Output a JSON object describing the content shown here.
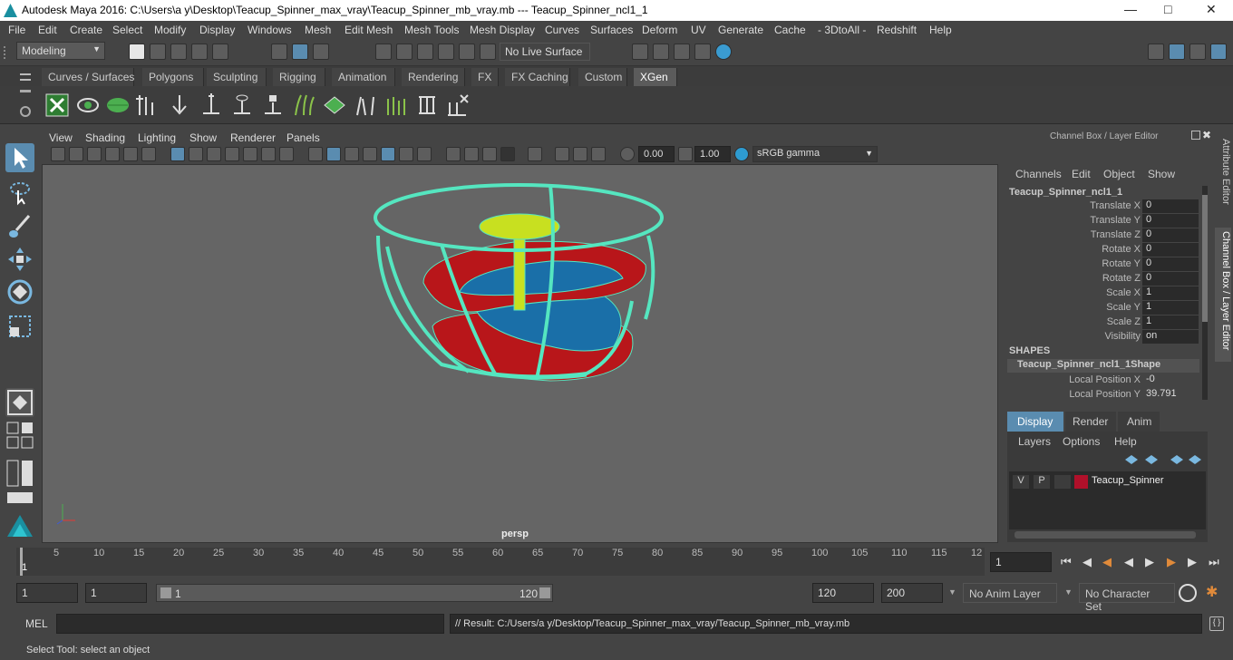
{
  "window": {
    "title": "Autodesk Maya 2016: C:\\Users\\a y\\Desktop\\Teacup_Spinner_max_vray\\Teacup_Spinner_mb_vray.mb   ---   Teacup_Spinner_ncl1_1"
  },
  "menubar": [
    "File",
    "Edit",
    "Create",
    "Select",
    "Modify",
    "Display",
    "Windows",
    "Mesh",
    "Edit Mesh",
    "Mesh Tools",
    "Mesh Display",
    "Curves",
    "Surfaces",
    "Deform",
    "UV",
    "Generate",
    "Cache",
    "- 3DtoAll -",
    "Redshift",
    "Help"
  ],
  "status": {
    "mode": "Modeling",
    "live_surface": "No Live Surface"
  },
  "shelf_tabs": [
    "Curves / Surfaces",
    "Polygons",
    "Sculpting",
    "Rigging",
    "Animation",
    "Rendering",
    "FX",
    "FX Caching",
    "Custom",
    "XGen"
  ],
  "active_shelf_tab": "XGen",
  "viewport": {
    "menu": [
      "View",
      "Shading",
      "Lighting",
      "Show",
      "Renderer",
      "Panels"
    ],
    "exposure": "0.00",
    "gamma": "1.00",
    "color_space": "sRGB gamma",
    "camera_label": "persp"
  },
  "channel_box": {
    "title": "Channel Box / Layer Editor",
    "menu": [
      "Channels",
      "Edit",
      "Object",
      "Show"
    ],
    "object": "Teacup_Spinner_ncl1_1",
    "attributes": [
      {
        "label": "Translate X",
        "value": "0"
      },
      {
        "label": "Translate Y",
        "value": "0"
      },
      {
        "label": "Translate Z",
        "value": "0"
      },
      {
        "label": "Rotate X",
        "value": "0"
      },
      {
        "label": "Rotate Y",
        "value": "0"
      },
      {
        "label": "Rotate Z",
        "value": "0"
      },
      {
        "label": "Scale X",
        "value": "1"
      },
      {
        "label": "Scale Y",
        "value": "1"
      },
      {
        "label": "Scale Z",
        "value": "1"
      },
      {
        "label": "Visibility",
        "value": "on"
      }
    ],
    "shapes_header": "SHAPES",
    "shape_name": "Teacup_Spinner_ncl1_1Shape",
    "shape_attributes": [
      {
        "label": "Local Position X",
        "value": "-0"
      },
      {
        "label": "Local Position Y",
        "value": "39.791"
      }
    ]
  },
  "layer_editor": {
    "tabs": [
      "Display",
      "Render",
      "Anim"
    ],
    "menu": [
      "Layers",
      "Options",
      "Help"
    ],
    "layer": {
      "v": "V",
      "p": "P",
      "name": "Teacup_Spinner",
      "color": "#b0102a"
    }
  },
  "side_tabs": [
    "Attribute Editor",
    "Channel Box / Layer Editor"
  ],
  "timeline": {
    "ticks": [
      "5",
      "10",
      "15",
      "20",
      "25",
      "30",
      "35",
      "40",
      "45",
      "50",
      "55",
      "60",
      "65",
      "70",
      "75",
      "80",
      "85",
      "90",
      "95",
      "100",
      "105",
      "110",
      "115",
      "12"
    ],
    "start_marker": "1",
    "current_frame": "1"
  },
  "range": {
    "start": "1",
    "playback_start": "1",
    "slider_start": "1",
    "slider_end": "120",
    "playback_end": "120",
    "end": "200",
    "anim_layer": "No Anim Layer",
    "character_set": "No Character Set"
  },
  "command_line": {
    "label": "MEL",
    "result": "// Result: C:/Users/a y/Desktop/Teacup_Spinner_max_vray/Teacup_Spinner_mb_vray.mb"
  },
  "help_line": "Select Tool: select an object",
  "colors": {
    "accent": "#5aa0c8",
    "wire": "#55e6c0",
    "red": "#b8161a",
    "blue": "#1a6fa8",
    "yellow": "#c8e020"
  }
}
